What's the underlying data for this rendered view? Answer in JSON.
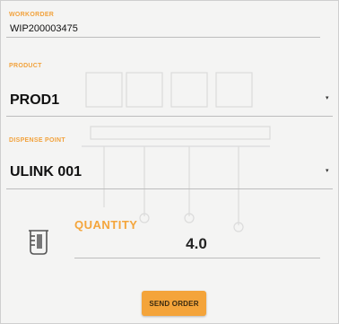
{
  "colors": {
    "accent": "#f4a43a",
    "text": "#111111",
    "divider": "#bdbdbd",
    "background": "#f4f4f3"
  },
  "workorder": {
    "label": "WORKORDER",
    "value": "WIP200003475"
  },
  "product": {
    "label": "PRODUCT",
    "value": "PROD1",
    "caret": "▾"
  },
  "dispense_point": {
    "label": "DISPENSE POINT",
    "value": "ULINK 001",
    "caret": "▾"
  },
  "quantity": {
    "label": "QUANTITY",
    "value": "4.0",
    "icon": "beaker-icon"
  },
  "send_order": {
    "label": "SEND ORDER"
  }
}
